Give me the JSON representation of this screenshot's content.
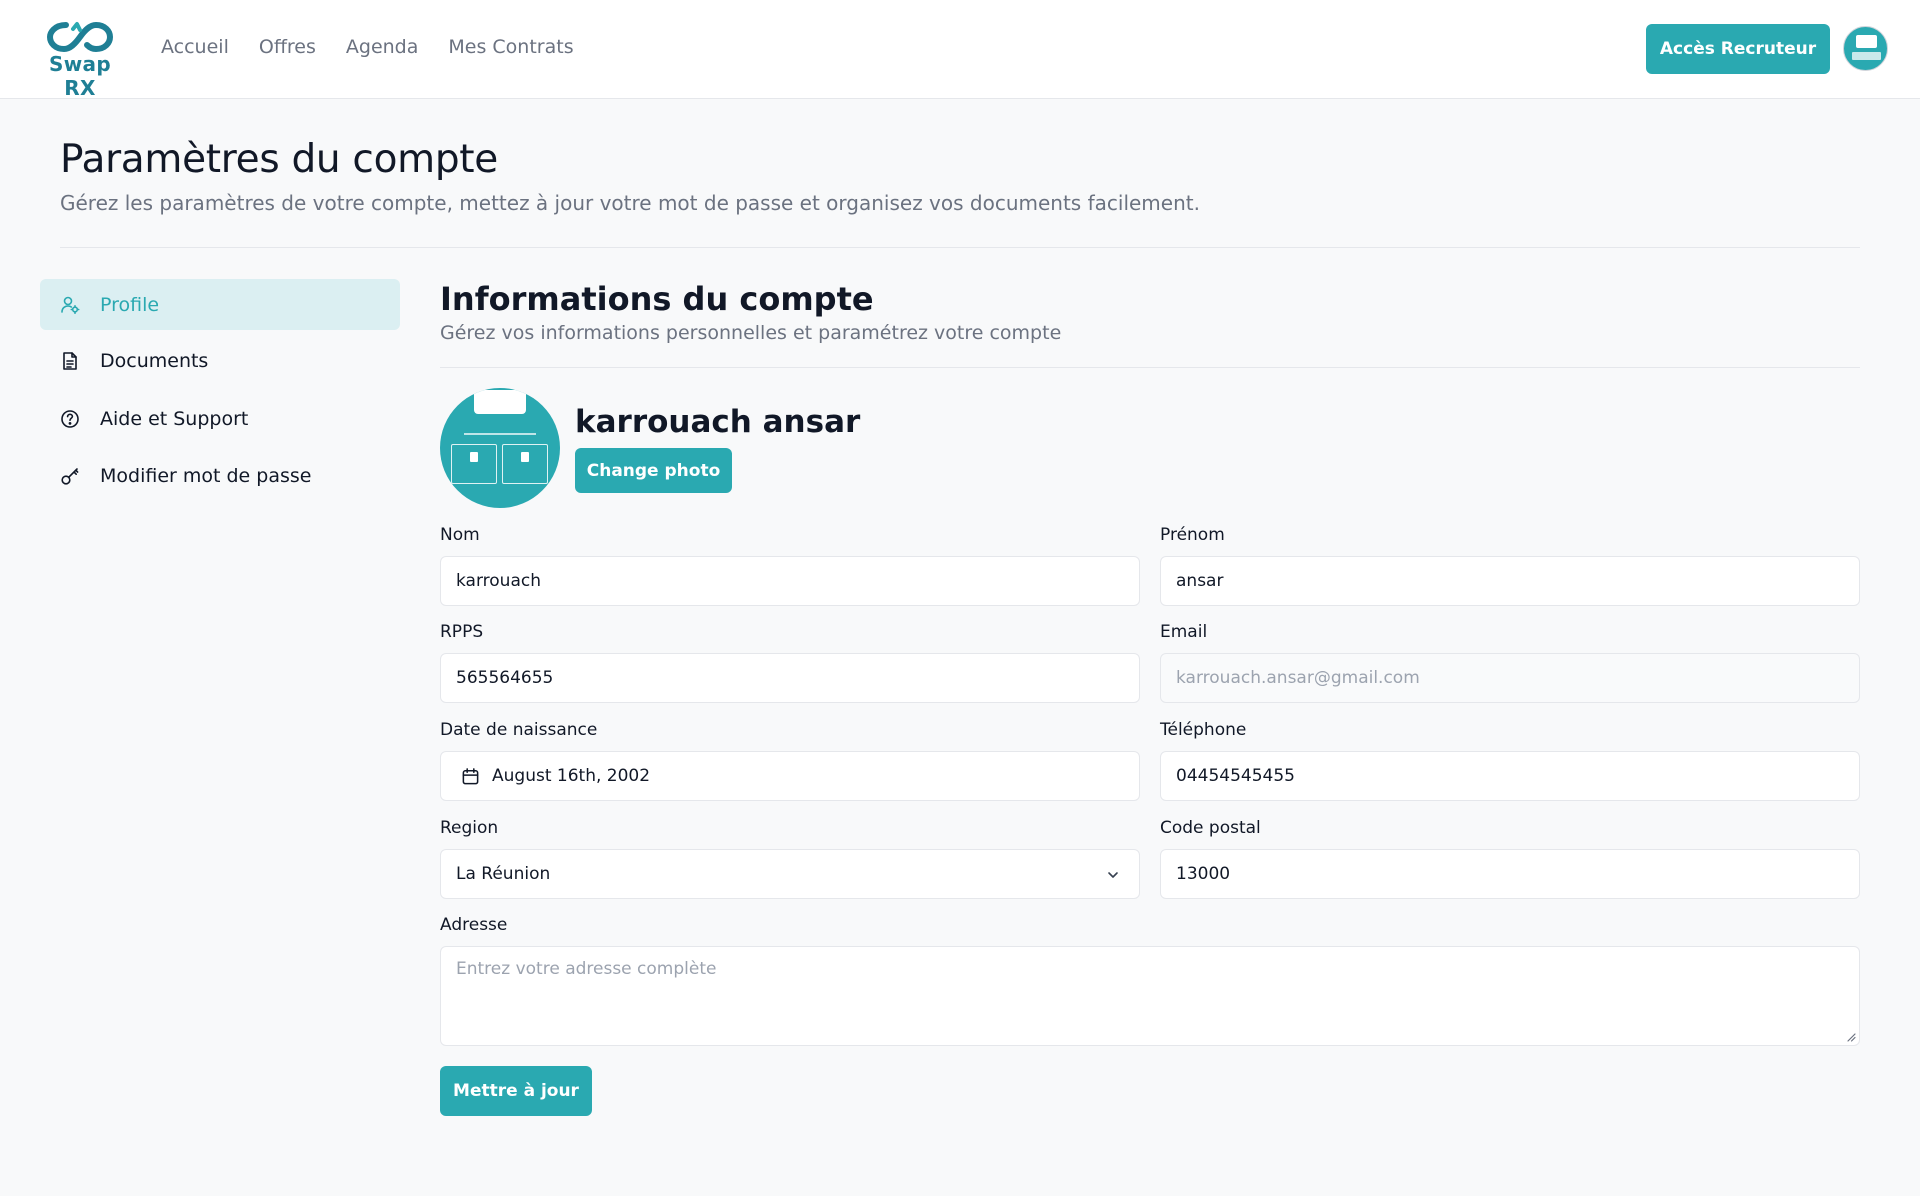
{
  "brand": {
    "name": "Swap RX",
    "accent": "#2aa9b1",
    "logo_color": "#1f7f95"
  },
  "nav": {
    "links": [
      "Accueil",
      "Offres",
      "Agenda",
      "Mes Contrats"
    ],
    "recruiter_button": "Accès Recruteur"
  },
  "header": {
    "title": "Paramètres du compte",
    "subtitle": "Gérez les paramètres de votre compte, mettez à jour votre mot de passe et organisez vos documents facilement."
  },
  "sidebar": {
    "items": [
      {
        "label": "Profile",
        "icon": "user-cog-icon",
        "active": true
      },
      {
        "label": "Documents",
        "icon": "document-icon",
        "active": false
      },
      {
        "label": "Aide et Support",
        "icon": "help-circle-icon",
        "active": false
      },
      {
        "label": "Modifier mot de passe",
        "icon": "key-icon",
        "active": false
      }
    ]
  },
  "account": {
    "title": "Informations du compte",
    "subtitle": "Gérez vos informations personnelles et paramétrez votre compte",
    "full_name": "karrouach ansar",
    "change_photo_label": "Change photo"
  },
  "form": {
    "nom": {
      "label": "Nom",
      "value": "karrouach"
    },
    "prenom": {
      "label": "Prénom",
      "value": "ansar"
    },
    "rpps": {
      "label": "RPPS",
      "value": "565564655"
    },
    "email": {
      "label": "Email",
      "value": "karrouach.ansar@gmail.com",
      "disabled": true
    },
    "naissance": {
      "label": "Date de naissance",
      "value": "August 16th, 2002"
    },
    "telephone": {
      "label": "Téléphone",
      "value": "04454545455"
    },
    "region": {
      "label": "Region",
      "value": "La Réunion"
    },
    "code_postal": {
      "label": "Code postal",
      "value": "13000"
    },
    "adresse": {
      "label": "Adresse",
      "placeholder": "Entrez votre adresse complète",
      "value": ""
    },
    "submit_label": "Mettre à jour"
  }
}
